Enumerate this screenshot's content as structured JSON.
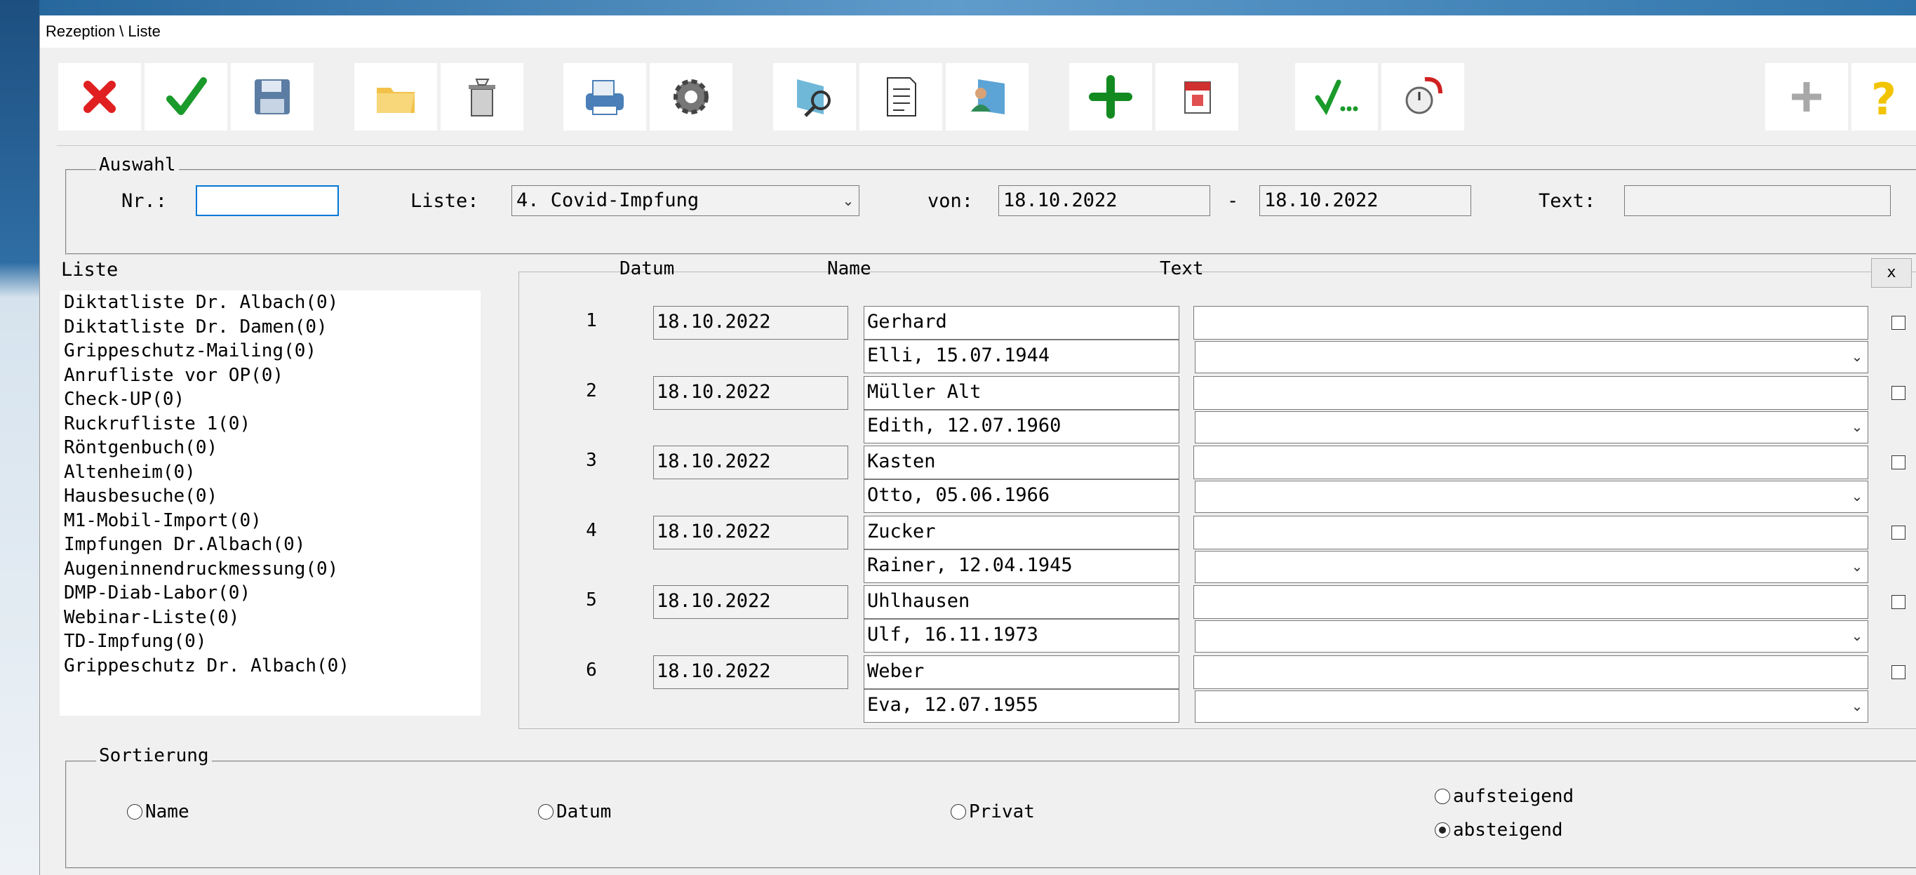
{
  "window": {
    "title": "Rezeption \\ Liste"
  },
  "toolbar": {
    "buttons": [
      {
        "icon": "cancel-icon"
      },
      {
        "icon": "confirm-check-icon"
      },
      {
        "icon": "save-disk-icon"
      },
      {
        "icon": "folder-icon"
      },
      {
        "icon": "trash-bin-icon"
      },
      {
        "icon": "printer-icon"
      },
      {
        "icon": "gear-icon"
      },
      {
        "icon": "search-magnifier-icon"
      },
      {
        "icon": "document-list-icon"
      },
      {
        "icon": "person-card-icon"
      },
      {
        "icon": "add-plus-icon"
      },
      {
        "icon": "calendar-icon"
      },
      {
        "icon": "check-more-icon"
      },
      {
        "icon": "stopwatch-icon"
      },
      {
        "icon": "gray-plus-icon"
      },
      {
        "icon": "help-question-icon"
      }
    ]
  },
  "auswahl": {
    "legend": "Auswahl",
    "nr_label": "Nr.:",
    "nr_value": "",
    "liste_label": "Liste:",
    "liste_value": "4. Covid-Impfung",
    "von_label": "von:",
    "von_value": "18.10.2022",
    "dash": "-",
    "bis_value": "18.10.2022",
    "text_label": "Text:",
    "text_value": ""
  },
  "liste": {
    "heading": "Liste",
    "items": [
      "Diktatliste Dr. Albach(0)",
      "Diktatliste Dr. Damen(0)",
      "Grippeschutz-Mailing(0)",
      "Anrufliste vor OP(0)",
      "Check-UP(0)",
      "Ruckrufliste 1(0)",
      "Röntgenbuch(0)",
      "Altenheim(0)",
      "Hausbesuche(0)",
      "M1-Mobil-Import(0)",
      "Impfungen Dr.Albach(0)",
      "Augeninnendruckmessung(0)",
      "DMP-Diab-Labor(0)",
      "Webinar-Liste(0)",
      "TD-Impfung(0)",
      "Grippeschutz Dr. Albach(0)"
    ]
  },
  "table": {
    "col_datum": "Datum",
    "col_name": "Name",
    "col_text": "Text",
    "col_x": "x",
    "rows": [
      {
        "nr": "1",
        "datum": "18.10.2022",
        "name": "Gerhard",
        "detail": "Elli, 15.07.1944",
        "text": ""
      },
      {
        "nr": "2",
        "datum": "18.10.2022",
        "name": "Müller Alt",
        "detail": "Edith, 12.07.1960",
        "text": ""
      },
      {
        "nr": "3",
        "datum": "18.10.2022",
        "name": "Kasten",
        "detail": "Otto, 05.06.1966",
        "text": ""
      },
      {
        "nr": "4",
        "datum": "18.10.2022",
        "name": "Zucker",
        "detail": "Rainer, 12.04.1945",
        "text": ""
      },
      {
        "nr": "5",
        "datum": "18.10.2022",
        "name": "Uhlhausen",
        "detail": "Ulf, 16.11.1973",
        "text": ""
      },
      {
        "nr": "6",
        "datum": "18.10.2022",
        "name": "Weber",
        "detail": "Eva, 12.07.1955",
        "text": ""
      }
    ]
  },
  "sortierung": {
    "legend": "Sortierung",
    "name": "Name",
    "datum": "Datum",
    "privat": "Privat",
    "aufsteigend": "aufsteigend",
    "absteigend": "absteigend",
    "selected_order": "absteigend"
  }
}
